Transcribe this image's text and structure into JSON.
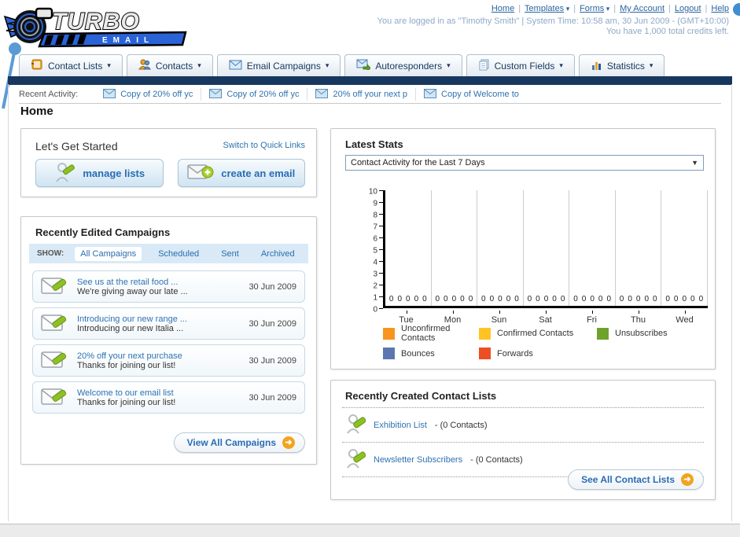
{
  "logo": {
    "title": "TURBO",
    "subtitle": "EMAIL"
  },
  "header": {
    "links": [
      {
        "label": "Home",
        "dropdown": false
      },
      {
        "label": "Templates",
        "dropdown": true
      },
      {
        "label": "Forms",
        "dropdown": true
      },
      {
        "label": "My Account",
        "dropdown": false
      },
      {
        "label": "Logout",
        "dropdown": false
      },
      {
        "label": "Help",
        "dropdown": false
      }
    ],
    "status_line1": "You are logged in as \"Timothy Smith\" | System Time: 10:58 am, 30 Jun 2009 - (GMT+10:00)",
    "status_line2": "You have 1,000 total credits left."
  },
  "nav_tabs": [
    {
      "label": "Contact Lists",
      "icon": "contact-lists-icon"
    },
    {
      "label": "Contacts",
      "icon": "contacts-icon"
    },
    {
      "label": "Email Campaigns",
      "icon": "email-campaigns-icon"
    },
    {
      "label": "Autoresponders",
      "icon": "autoresponders-icon"
    },
    {
      "label": "Custom Fields",
      "icon": "custom-fields-icon"
    },
    {
      "label": "Statistics",
      "icon": "statistics-icon"
    }
  ],
  "recent_activity": {
    "label": "Recent Activity:",
    "items": [
      "Copy of 20% off yc",
      "Copy of 20% off yc",
      "20% off your next p",
      "Copy of Welcome to"
    ]
  },
  "page_title": "Home",
  "get_started": {
    "title": "Let's Get Started",
    "switch_link": "Switch to Quick Links",
    "buttons": [
      {
        "label": "manage lists",
        "icon": "manage-lists-icon"
      },
      {
        "label": "create an email",
        "icon": "create-email-icon"
      }
    ]
  },
  "campaigns": {
    "title": "Recently Edited Campaigns",
    "show_label": "SHOW:",
    "filters": [
      "All Campaigns",
      "Scheduled",
      "Sent",
      "Archived"
    ],
    "active_filter": "All Campaigns",
    "rows": [
      {
        "title": "See us at the retail food ...",
        "subtitle": "We're giving away our late ...",
        "date": "30 Jun 2009"
      },
      {
        "title": "Introducing our new range ...",
        "subtitle": "Introducing our new Italia ...",
        "date": "30 Jun 2009"
      },
      {
        "title": "20% off your next purchase",
        "subtitle": "Thanks for joining our list!",
        "date": "30 Jun 2009"
      },
      {
        "title": "Welcome to our email list",
        "subtitle": "Thanks for joining our list!",
        "date": "30 Jun 2009"
      }
    ],
    "view_all": "View All Campaigns"
  },
  "latest_stats": {
    "title": "Latest Stats",
    "dropdown_value": "Contact Activity for the Last 7 Days"
  },
  "chart_data": {
    "type": "bar",
    "title": "Contact Activity for the Last 7 Days",
    "categories": [
      "Tue",
      "Mon",
      "Sun",
      "Sat",
      "Fri",
      "Thu",
      "Wed"
    ],
    "series": [
      {
        "name": "Unconfirmed Contacts",
        "color": "#F7941E",
        "values": [
          0,
          0,
          0,
          0,
          0,
          0,
          0
        ]
      },
      {
        "name": "Confirmed Contacts",
        "color": "#FFC423",
        "values": [
          0,
          0,
          0,
          0,
          0,
          0,
          0
        ]
      },
      {
        "name": "Unsubscribes",
        "color": "#6FA22B",
        "values": [
          0,
          0,
          0,
          0,
          0,
          0,
          0
        ]
      },
      {
        "name": "Bounces",
        "color": "#5C77B0",
        "values": [
          0,
          0,
          0,
          0,
          0,
          0,
          0
        ]
      },
      {
        "name": "Forwards",
        "color": "#EE4E23",
        "values": [
          0,
          0,
          0,
          0,
          0,
          0,
          0
        ]
      }
    ],
    "ylim": [
      0,
      10
    ],
    "yticks": [
      0,
      1,
      2,
      3,
      4,
      5,
      6,
      7,
      8,
      9,
      10
    ],
    "grid": "vertical",
    "legend_position": "bottom",
    "value_labels_shown": true
  },
  "contact_lists": {
    "title": "Recently Created Contact Lists",
    "rows": [
      {
        "name": "Exhibition List",
        "detail": "- (0 Contacts)"
      },
      {
        "name": "Newsletter Subscribers",
        "detail": "- (0 Contacts)"
      }
    ],
    "see_all": "See All Contact Lists"
  },
  "colors": {
    "navy_bar": "#17375E",
    "link_blue": "#2E73B0",
    "accent_orange": "#F2A41F",
    "show_bar_bg": "#D9EAF6"
  }
}
